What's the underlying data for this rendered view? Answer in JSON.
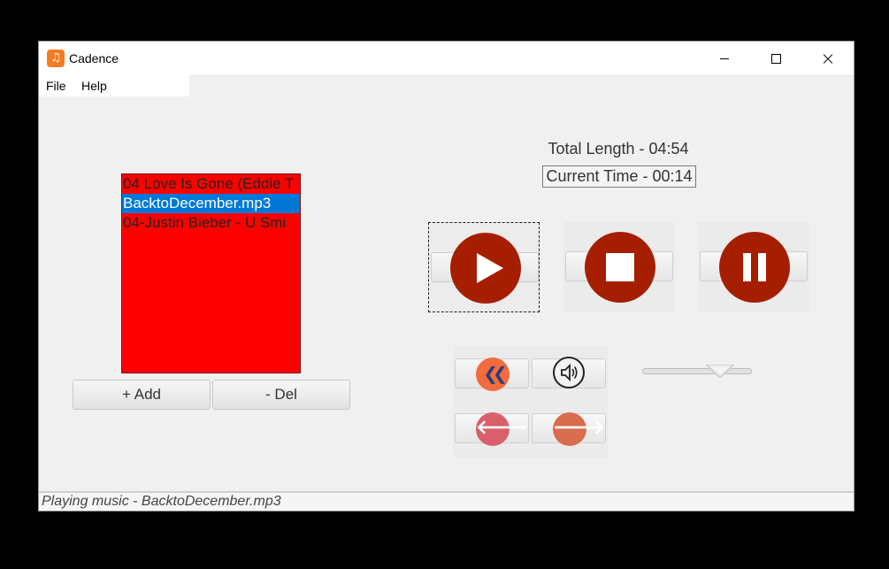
{
  "window": {
    "title": "Cadence",
    "app_icon": "music-note-icon"
  },
  "menu": {
    "items": [
      "File",
      "Help"
    ]
  },
  "playlist": {
    "items": [
      {
        "label": "04 Love Is Gone (Eddie T"
      },
      {
        "label": "BacktoDecember.mp3",
        "selected": true
      },
      {
        "label": "04-Justin Bieber - U Smi"
      }
    ],
    "background_color": "#ff0000",
    "selected_color": "#0078d7"
  },
  "buttons": {
    "add": "+ Add",
    "del": "- Del"
  },
  "time": {
    "total_length": "Total Length - 04:54",
    "current_time": "Current Time - 00:14"
  },
  "controls": {
    "accent_color": "#a61e00",
    "play_icon": "play-icon",
    "stop_icon": "stop-icon",
    "pause_icon": "pause-icon",
    "rewind_icon": "double-chevron-left-icon",
    "volume_icon": "speaker-icon",
    "prev_icon": "arrow-left-icon",
    "next_icon": "arrow-right-icon"
  },
  "status": {
    "text": "Playing music - BacktoDecember.mp3"
  }
}
